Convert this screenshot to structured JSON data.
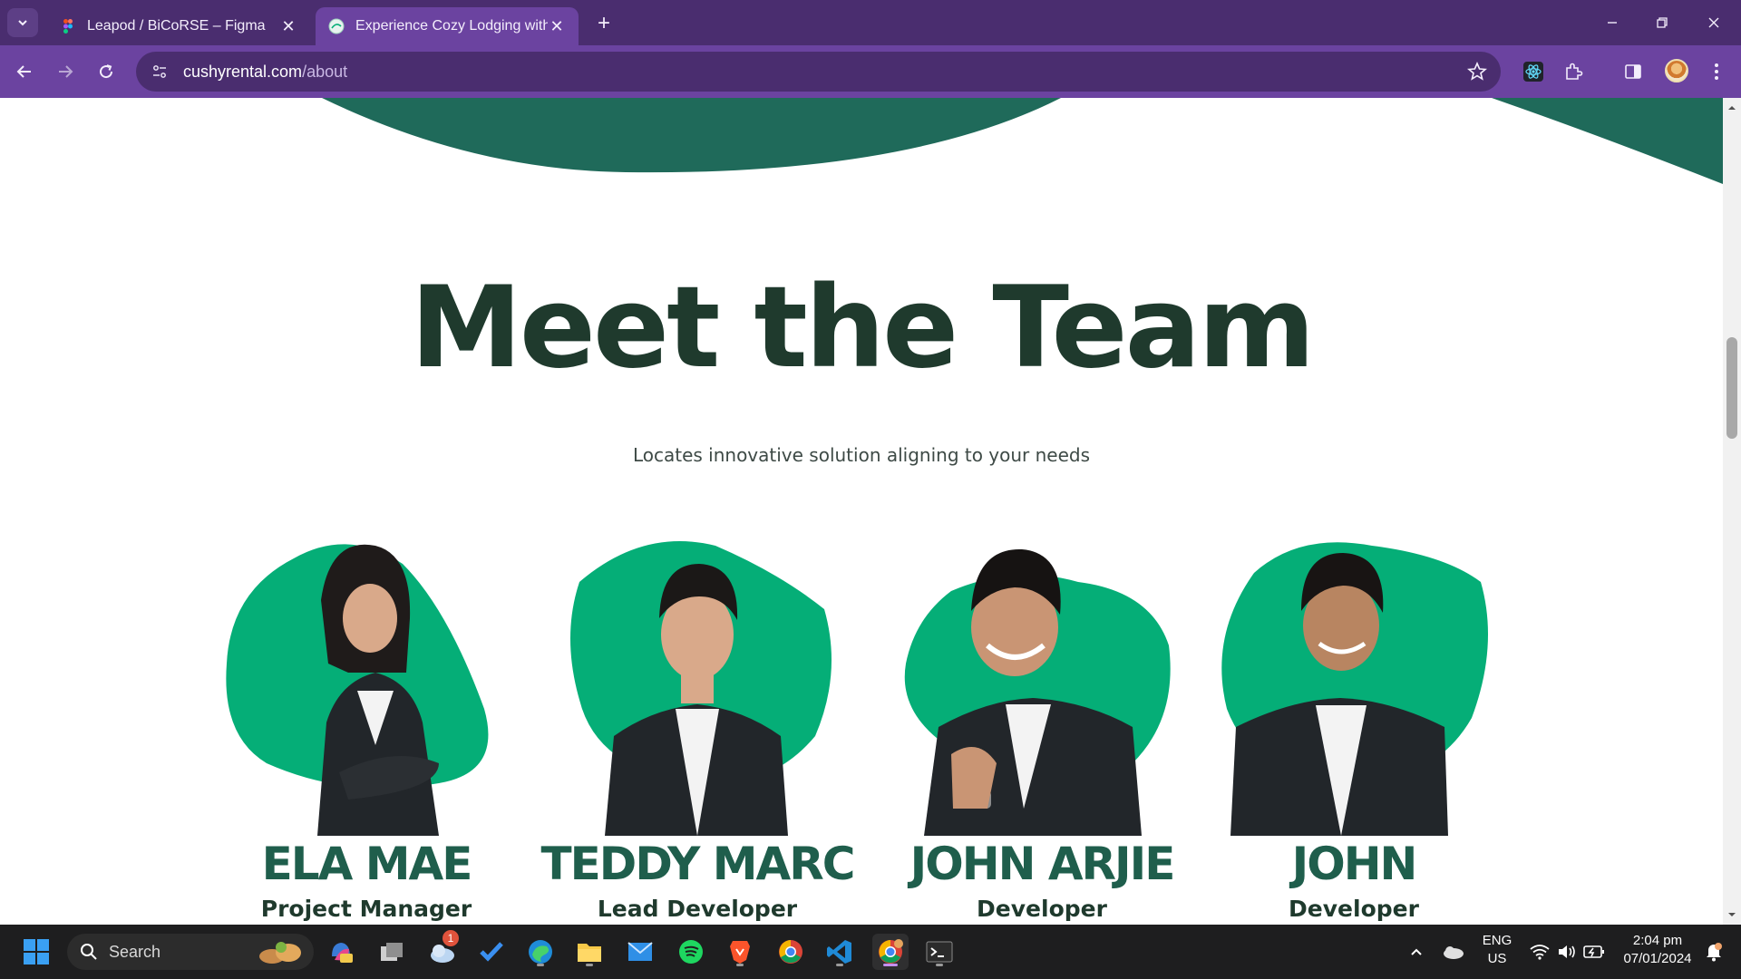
{
  "browser": {
    "tabs": [
      {
        "title": "Leapod / BiCoRSE – Figma",
        "active": false
      },
      {
        "title": "Experience Cozy Lodging with C",
        "active": true
      }
    ],
    "url_domain": "cushyrental.com",
    "url_path": "/about",
    "icons": [
      "tab-search-icon",
      "figma-icon",
      "site-icon",
      "close-icon",
      "plus-icon",
      "minimize-icon",
      "restore-icon",
      "close-window-icon",
      "back-icon",
      "forward-icon",
      "reload-icon",
      "site-info-icon",
      "star-icon",
      "react-devtools-icon",
      "extensions-icon",
      "side-panel-icon",
      "profile-avatar",
      "more-icon"
    ]
  },
  "page": {
    "heading": "Meet the Team",
    "subheading": "Locates innovative solution aligning to your needs",
    "accent_color": "#05ae77",
    "dark_green": "#1f3a2d",
    "team": [
      {
        "name": "ELA MAE",
        "role": "Project Manager"
      },
      {
        "name": "TEDDY MARC",
        "role": "Lead Developer"
      },
      {
        "name": "JOHN ARJIE",
        "role": "Developer"
      },
      {
        "name": "JOHN",
        "role": "Developer"
      }
    ]
  },
  "taskbar": {
    "search_label": "Search",
    "notification_badge": "1",
    "language": "ENG",
    "region": "US",
    "time": "2:04 pm",
    "date": "07/01/2024"
  }
}
